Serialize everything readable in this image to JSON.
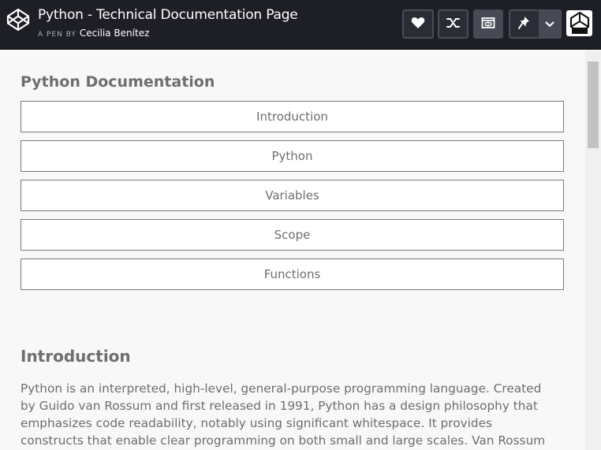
{
  "header": {
    "title": "Python - Technical Documentation Page",
    "byline_prefix": "A PEN BY",
    "author": "Cecilia Benítez",
    "icons": [
      "codepen-logo-icon",
      "heart-icon",
      "fork-icon",
      "view-icon",
      "pin-icon",
      "chevron-down-icon",
      "avatar-icon"
    ]
  },
  "doc": {
    "title": "Python Documentation",
    "nav": [
      {
        "label": "Introduction"
      },
      {
        "label": "Python"
      },
      {
        "label": "Variables"
      },
      {
        "label": "Scope"
      },
      {
        "label": "Functions"
      }
    ]
  },
  "section": {
    "title": "Introduction",
    "body": "Python is an interpreted, high-level, general-purpose programming language. Created by Guido van Rossum and first released in 1991, Python has a design philosophy that emphasizes code readability, notably using significant whitespace. It provides constructs that enable clear programming on both small and large scales. Van Rossum led the"
  }
}
